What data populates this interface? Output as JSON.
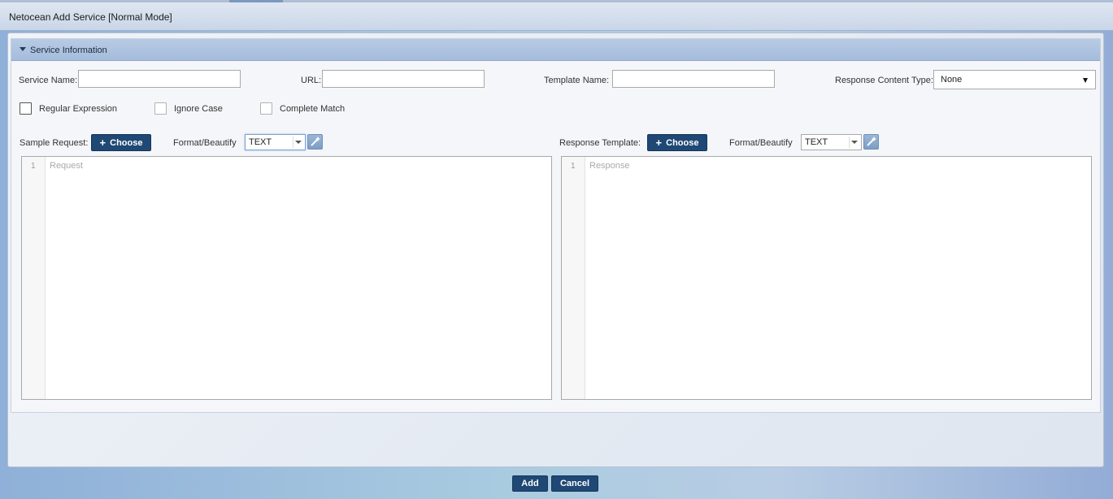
{
  "window": {
    "title": "Netocean Add Service [Normal Mode]"
  },
  "section": {
    "title": "Service Information"
  },
  "fields": {
    "service_name": {
      "label": "Service Name:",
      "value": ""
    },
    "url": {
      "label": "URL:",
      "value": ""
    },
    "template_name": {
      "label": "Template Name:",
      "value": ""
    },
    "response_content_type": {
      "label": "Response Content Type:",
      "value": "None"
    }
  },
  "checkboxes": {
    "regular_expression": {
      "label": "Regular Expression",
      "checked": false
    },
    "ignore_case": {
      "label": "Ignore Case",
      "checked": false
    },
    "complete_match": {
      "label": "Complete Match",
      "checked": false
    }
  },
  "request": {
    "label": "Sample Request:",
    "choose_label": "Choose",
    "format_label": "Format/Beautify",
    "format_value": "TEXT",
    "line_number": "1",
    "placeholder": "Request"
  },
  "response": {
    "label": "Response Template:",
    "choose_label": "Choose",
    "format_label": "Format/Beautify",
    "format_value": "TEXT",
    "line_number": "1",
    "placeholder": "Response"
  },
  "footer": {
    "add_label": "Add",
    "cancel_label": "Cancel"
  },
  "icons": {
    "plus": "plus-icon",
    "wand": "magic-wand-icon",
    "collapse": "triangle-down-icon"
  },
  "colors": {
    "primary_button": "#1f4874",
    "header_band": "#a4bcdc"
  }
}
